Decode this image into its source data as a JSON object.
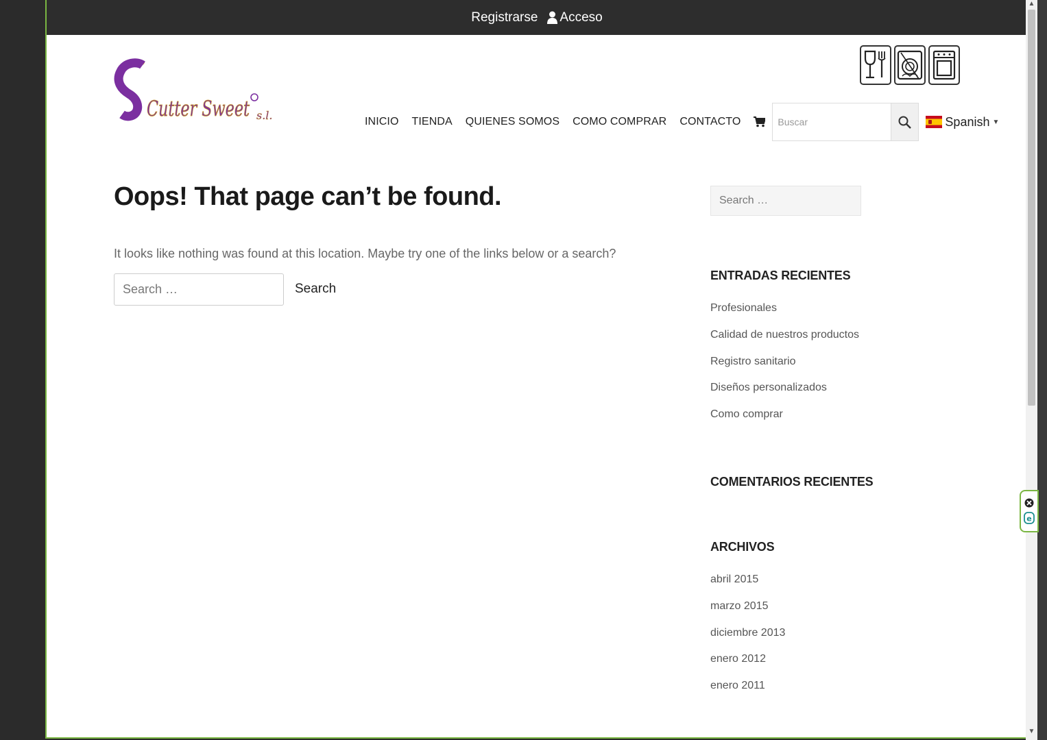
{
  "topbar": {
    "register": "Registrarse",
    "login": "Acceso"
  },
  "logo": {
    "text": "Cutter Sweet",
    "suffix": "s.l."
  },
  "badges": [
    "food-safe-icon",
    "dishwasher-safe-icon",
    "oven-safe-icon"
  ],
  "nav": {
    "items": [
      "INICIO",
      "TIENDA",
      "QUIENES SOMOS",
      "COMO COMPRAR",
      "CONTACTO"
    ],
    "search_placeholder": "Buscar",
    "language": "Spanish"
  },
  "main": {
    "title": "Oops! That page can’t be found.",
    "text": "It looks like nothing was found at this location. Maybe try one of the links below or a search?",
    "search_placeholder": "Search …",
    "search_button": "Search"
  },
  "sidebar": {
    "search_placeholder": "Search …",
    "recent_posts_title": "ENTRADAS RECIENTES",
    "recent_posts": [
      "Profesionales",
      "Calidad de nuestros productos",
      "Registro sanitario",
      "Diseños personalizados",
      "Como comprar"
    ],
    "recent_comments_title": "COMENTARIOS RECIENTES",
    "archives_title": "ARCHIVOS",
    "archives": [
      "abril 2015",
      "marzo 2015",
      "diciembre 2013",
      "enero 2012",
      "enero 2011"
    ]
  },
  "colors": {
    "accent_green": "#7ab642",
    "logo_purple": "#7b2fa0",
    "logo_gold": "#c99a1c",
    "topbar_bg": "#2d2d2d"
  }
}
